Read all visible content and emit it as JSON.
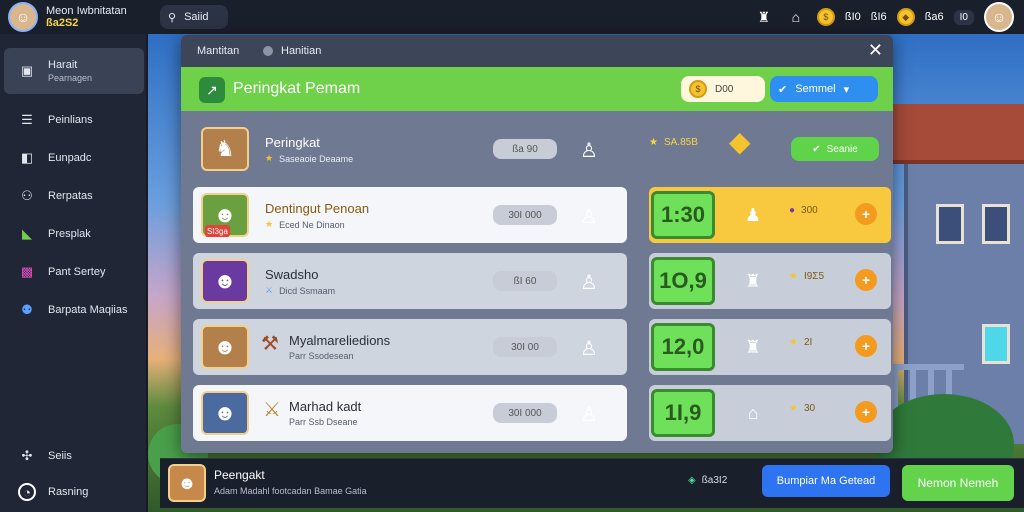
{
  "topbar": {
    "profile_name": "Meon Iwbnitatan",
    "profile_coins": "ßa2S2",
    "search_label": "Saiid",
    "icons": [
      "trophy-icon",
      "lock-icon",
      "coin-icon",
      "gem-icon"
    ],
    "stat1": "ßI0",
    "stat2": "ßI6",
    "stat3": "ßa6",
    "stat4": "I0"
  },
  "sidebar": {
    "items": [
      {
        "label": "Harait",
        "sub": "Pearnagen",
        "icon": "home-icon"
      },
      {
        "label": "Peinlians",
        "icon": "list-icon"
      },
      {
        "label": "Eunpadc",
        "icon": "box-icon"
      },
      {
        "label": "Rerpatas",
        "icon": "users-icon"
      },
      {
        "label": "Presplak",
        "icon": "tag-icon"
      },
      {
        "label": "Pant Sertey",
        "icon": "chat-icon"
      },
      {
        "label": "Barpata Maqiias",
        "icon": "group-icon"
      }
    ],
    "bottom": [
      {
        "label": "Seiis",
        "icon": "settings-icon"
      },
      {
        "label": "Rasning",
        "icon": "refresh-icon"
      }
    ]
  },
  "modal": {
    "crumb1": "Mantitan",
    "crumb2": "Hanitian",
    "title": "Peringkat Pemam",
    "pill_value": "D00",
    "semmel_label": "Semmel",
    "rows": [
      {
        "name": "Peringkat",
        "sub": "Saseaoie Deaame",
        "score": "ßa 90",
        "badge": "",
        "extra": "SA.85B",
        "greenbtn": "Seanie"
      },
      {
        "name": "Dentingut Penoan",
        "sub": "Eced Ne Dinaon",
        "score": "30I 000",
        "badge": "SI3ga",
        "timer": "1:30",
        "reward": "300"
      },
      {
        "name": "Swadsho",
        "sub": "Dicd Ssmaam",
        "score": "ßI 60",
        "badge": "",
        "timer": "1O,9",
        "reward": "I9Σ5"
      },
      {
        "name": "Myalmareliedions",
        "sub": "Parr Ssodesean",
        "score": "30I 00",
        "badge": "",
        "timer": "12,0",
        "reward": "2I"
      },
      {
        "name": "Marhad kadt",
        "sub": "Parr Ssb Dseane",
        "score": "30I 000",
        "badge": "",
        "timer": "1I,9",
        "reward": "30"
      }
    ]
  },
  "bottombar": {
    "title": "Peengakt",
    "sub": "Adam Madahl footcadan Bamae Gatia",
    "stat": "ßa3I2",
    "btn1": "Bumpiar Ma Getead",
    "btn2": "Nemon Nemeh"
  },
  "colors": {
    "accent_green": "#6fd04a",
    "accent_blue": "#2f8ff0",
    "gold": "#f8c93e",
    "orange": "#f39a1f"
  }
}
